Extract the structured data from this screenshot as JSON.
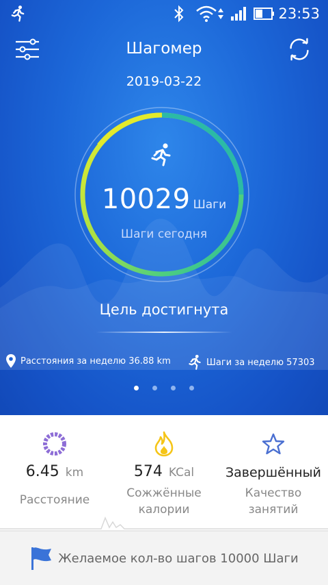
{
  "status": {
    "time": "23:53"
  },
  "header": {
    "title": "Шагомер",
    "date": "2019-03-22"
  },
  "ring": {
    "steps": "10029",
    "steps_unit": "Шаги",
    "subtitle": "Шаги сегодня",
    "progress": 1.0
  },
  "goal": {
    "text": "Цель достигнута"
  },
  "weekly": {
    "distance_text": "Расстояния за неделю 36.88 km",
    "steps_text": "Шаги за неделю 57303"
  },
  "pager": {
    "count": 4,
    "active": 0
  },
  "stats": [
    {
      "value": "6.45",
      "unit": "km",
      "label_line1": "Расстояние",
      "label_line2": ""
    },
    {
      "value": "574",
      "unit": "KCal",
      "label_line1": "Сожжённые",
      "label_line2": "калории"
    },
    {
      "value": "Завершённый",
      "unit": "",
      "label_line1": "Качество",
      "label_line2": "занятий"
    }
  ],
  "footer": {
    "target_text": "Желаемое кол-во шагов 10000 Шаги"
  },
  "colors": {
    "accent_purple": "#8d6dd6",
    "flame_yellow": "#f5c518",
    "star_blue": "#4a6fd1",
    "flag_blue": "#3a73d8"
  }
}
